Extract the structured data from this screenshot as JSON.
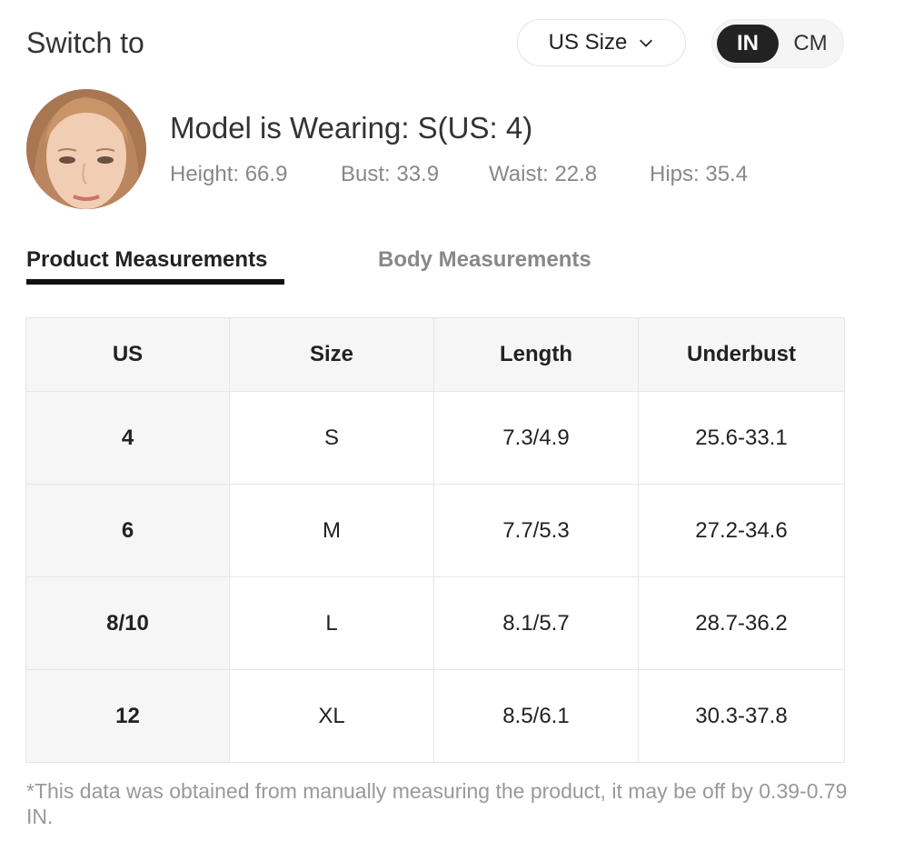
{
  "header": {
    "switch_label": "Switch to",
    "size_system": "US Size",
    "units": {
      "active": "IN",
      "inactive": "CM"
    }
  },
  "model": {
    "title": "Model is Wearing: S(US: 4)",
    "stats": {
      "height": "Height: 66.9",
      "bust": "Bust: 33.9",
      "waist": "Waist: 22.8",
      "hips": "Hips: 35.4"
    }
  },
  "tabs": [
    {
      "label": "Product Measurements",
      "active": true
    },
    {
      "label": "Body Measurements",
      "active": false
    }
  ],
  "table": {
    "headers": [
      "US",
      "Size",
      "Length",
      "Underbust"
    ],
    "rows": [
      [
        "4",
        "S",
        "7.3/4.9",
        "25.6-33.1"
      ],
      [
        "6",
        "M",
        "7.7/5.3",
        "27.2-34.6"
      ],
      [
        "8/10",
        "L",
        "8.1/5.7",
        "28.7-36.2"
      ],
      [
        "12",
        "XL",
        "8.5/6.1",
        "30.3-37.8"
      ]
    ]
  },
  "note": "*This data was obtained from manually measuring the product, it may be off by 0.39-0.79 IN.",
  "colors": {
    "accent": "#222222",
    "muted": "#888888",
    "table_header_bg": "#f6f6f6",
    "border": "#e6e6e6"
  },
  "icons": {
    "dropdown": "chevron-down-icon"
  }
}
